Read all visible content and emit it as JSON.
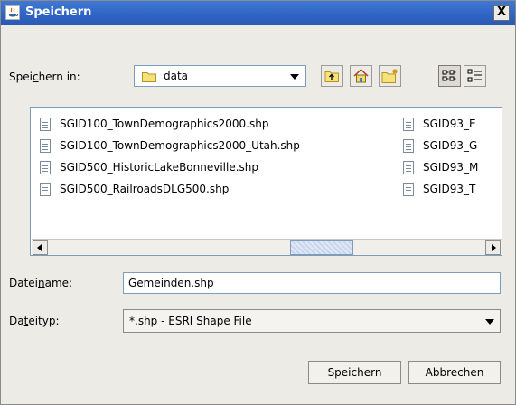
{
  "window": {
    "title": "Speichern",
    "close_glyph": "X"
  },
  "save_in": {
    "label_pre": "Spei",
    "label_underlined": "c",
    "label_post": "hern in:",
    "value": "data"
  },
  "toolbar": {
    "icons": [
      "up-folder-icon",
      "home-icon",
      "new-folder-icon",
      "list-view-icon",
      "details-view-icon"
    ]
  },
  "files": {
    "column1": [
      "SGID100_TownDemographics2000.shp",
      "SGID100_TownDemographics2000_Utah.shp",
      "SGID500_HistoricLakeBonneville.shp",
      "SGID500_RailroadsDLG500.shp"
    ],
    "column2": [
      "SGID93_E",
      "SGID93_G",
      "SGID93_M",
      "SGID93_T"
    ]
  },
  "filename": {
    "label_pre": "Datei",
    "label_underlined": "n",
    "label_post": "ame:",
    "value": "Gemeinden.shp"
  },
  "filetype": {
    "label_pre": "Da",
    "label_underlined": "t",
    "label_post": "eityp:",
    "value": "*.shp - ESRI Shape File"
  },
  "buttons": {
    "save": "Speichern",
    "cancel": "Abbrechen"
  }
}
